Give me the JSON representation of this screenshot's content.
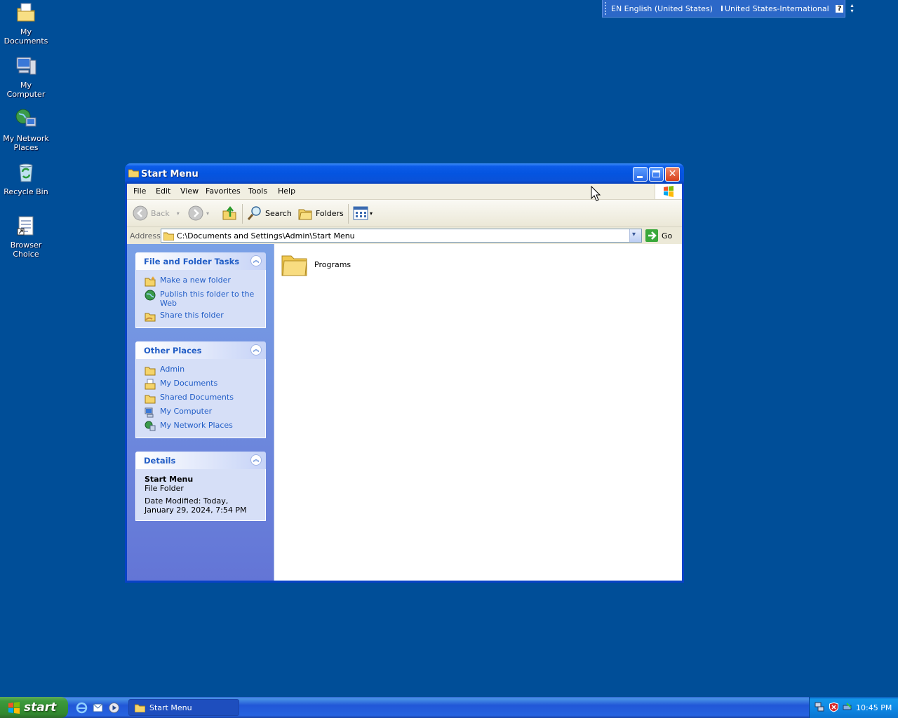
{
  "desktop": {
    "icons": [
      {
        "label": "My Documents"
      },
      {
        "label": "My Computer"
      },
      {
        "label": "My Network Places"
      },
      {
        "label": "Recycle Bin"
      },
      {
        "label": "Browser Choice"
      }
    ]
  },
  "langbar": {
    "language": "EN English (United States)",
    "keyboard": "United States-International",
    "help": "?"
  },
  "window": {
    "title": "Start Menu",
    "menu": [
      "File",
      "Edit",
      "View",
      "Favorites",
      "Tools",
      "Help"
    ],
    "toolbar": {
      "back": "Back",
      "search": "Search",
      "folders": "Folders"
    },
    "address": {
      "label": "Address",
      "path": "C:\\Documents and Settings\\Admin\\Start Menu",
      "go": "Go"
    },
    "panels": {
      "file_tasks": {
        "title": "File and Folder Tasks",
        "items": [
          "Make a new folder",
          "Publish this folder to the Web",
          "Share this folder"
        ]
      },
      "other_places": {
        "title": "Other Places",
        "items": [
          "Admin",
          "My Documents",
          "Shared Documents",
          "My Computer",
          "My Network Places"
        ]
      },
      "details": {
        "title": "Details",
        "name": "Start Menu",
        "type": "File Folder",
        "modified": "Date Modified: Today, January 29, 2024, 7:54 PM"
      }
    },
    "content": {
      "items": [
        {
          "label": "Programs"
        }
      ]
    }
  },
  "taskbar": {
    "start": "start",
    "task": "Start Menu",
    "clock": "10:45 PM"
  },
  "colors": {
    "desktop": "#004e98",
    "link": "#215dc6",
    "title_bar": "#0454e0",
    "start_green": "#3c9a3c"
  }
}
